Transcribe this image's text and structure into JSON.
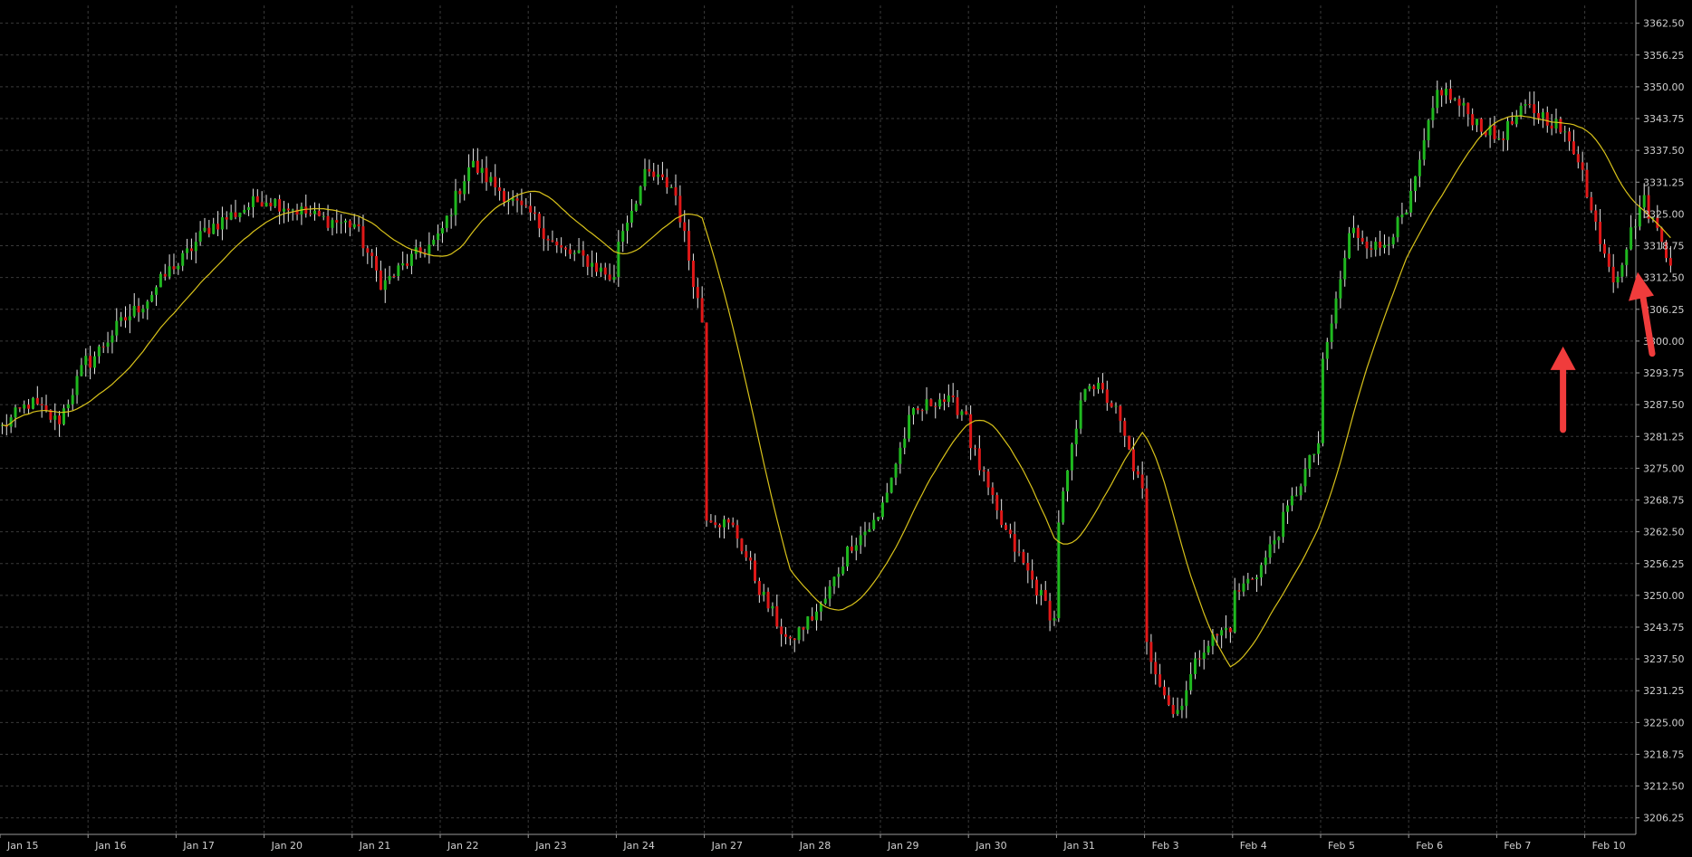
{
  "chart_data": {
    "type": "candlestick",
    "title": "",
    "xlabel": "",
    "ylabel": "",
    "ylim": [
      3203.0,
      3366.0
    ],
    "y_ticks": [
      "3362.50",
      "3356.25",
      "3350.00",
      "3343.75",
      "3337.50",
      "3331.25",
      "3325.00",
      "3318.75",
      "3312.50",
      "3306.25",
      "3300.00",
      "3293.75",
      "3287.50",
      "3281.25",
      "3275.00",
      "3268.75",
      "3262.50",
      "3256.25",
      "3250.00",
      "3243.75",
      "3237.50",
      "3231.25",
      "3225.00",
      "3218.75",
      "3212.50",
      "3206.25"
    ],
    "x_ticks": [
      "Jan 15",
      "Jan 16",
      "Jan 17",
      "Jan 20",
      "Jan 21",
      "Jan 22",
      "Jan 23",
      "Jan 24",
      "Jan 27",
      "Jan 28",
      "Jan 29",
      "Jan 30",
      "Jan 31",
      "Feb 3",
      "Feb 4",
      "Feb 5",
      "Feb 6",
      "Feb 7",
      "Feb 10"
    ],
    "price_path": [
      [
        "Jan 15",
        3283,
        3288,
        3284,
        3296
      ],
      [
        "Jan 16",
        3296,
        3303,
        3308,
        3315
      ],
      [
        "Jan 17",
        3315,
        3322,
        3325,
        3328
      ],
      [
        "Jan 20",
        3328,
        3326,
        3324,
        3323
      ],
      [
        "Jan 21",
        3323,
        3311,
        3316,
        3320
      ],
      [
        "Jan 22",
        3322,
        3335,
        3330,
        3325
      ],
      [
        "Jan 23",
        3325,
        3318,
        3316,
        3312
      ],
      [
        "Jan 24",
        3320,
        3333,
        3330,
        3304
      ],
      [
        "Jan 27",
        3266,
        3263,
        3250,
        3240
      ],
      [
        "Jan 28",
        3242,
        3248,
        3260,
        3265
      ],
      [
        "Jan 29",
        3268,
        3285,
        3289,
        3286
      ],
      [
        "Jan 30",
        3280,
        3265,
        3255,
        3245
      ],
      [
        "Jan 31",
        3265,
        3293,
        3287,
        3270
      ],
      [
        "Feb 3",
        3240,
        3226,
        3240,
        3244
      ],
      [
        "Feb 4",
        3250,
        3256,
        3268,
        3280
      ],
      [
        "Feb 5",
        3295,
        3322,
        3318,
        3325
      ],
      [
        "Feb 6",
        3328,
        3350,
        3345,
        3340
      ],
      [
        "Feb 7",
        3340,
        3346,
        3343,
        3335
      ],
      [
        "Feb 10",
        3328,
        3312,
        3328,
        3316
      ]
    ],
    "series": [
      {
        "name": "",
        "type": "moving-average",
        "color": "#d8c21a"
      }
    ],
    "colors": {
      "background": "#000000",
      "up": "#1fb81f",
      "down": "#e01818",
      "wick": "#e6e6e6",
      "grid": "#3a3a3a",
      "moving_average": "#d8c21a",
      "annotation_arrow": "#f03c3c"
    },
    "grid": true,
    "annotations": [
      {
        "type": "arrow",
        "direction": "up",
        "at": "Feb 10",
        "price": 3300.0,
        "color": "#f03c3c"
      },
      {
        "type": "arrow",
        "direction": "up-left",
        "at": "Feb 10",
        "price": 3312.5,
        "color": "#f03c3c"
      }
    ]
  }
}
